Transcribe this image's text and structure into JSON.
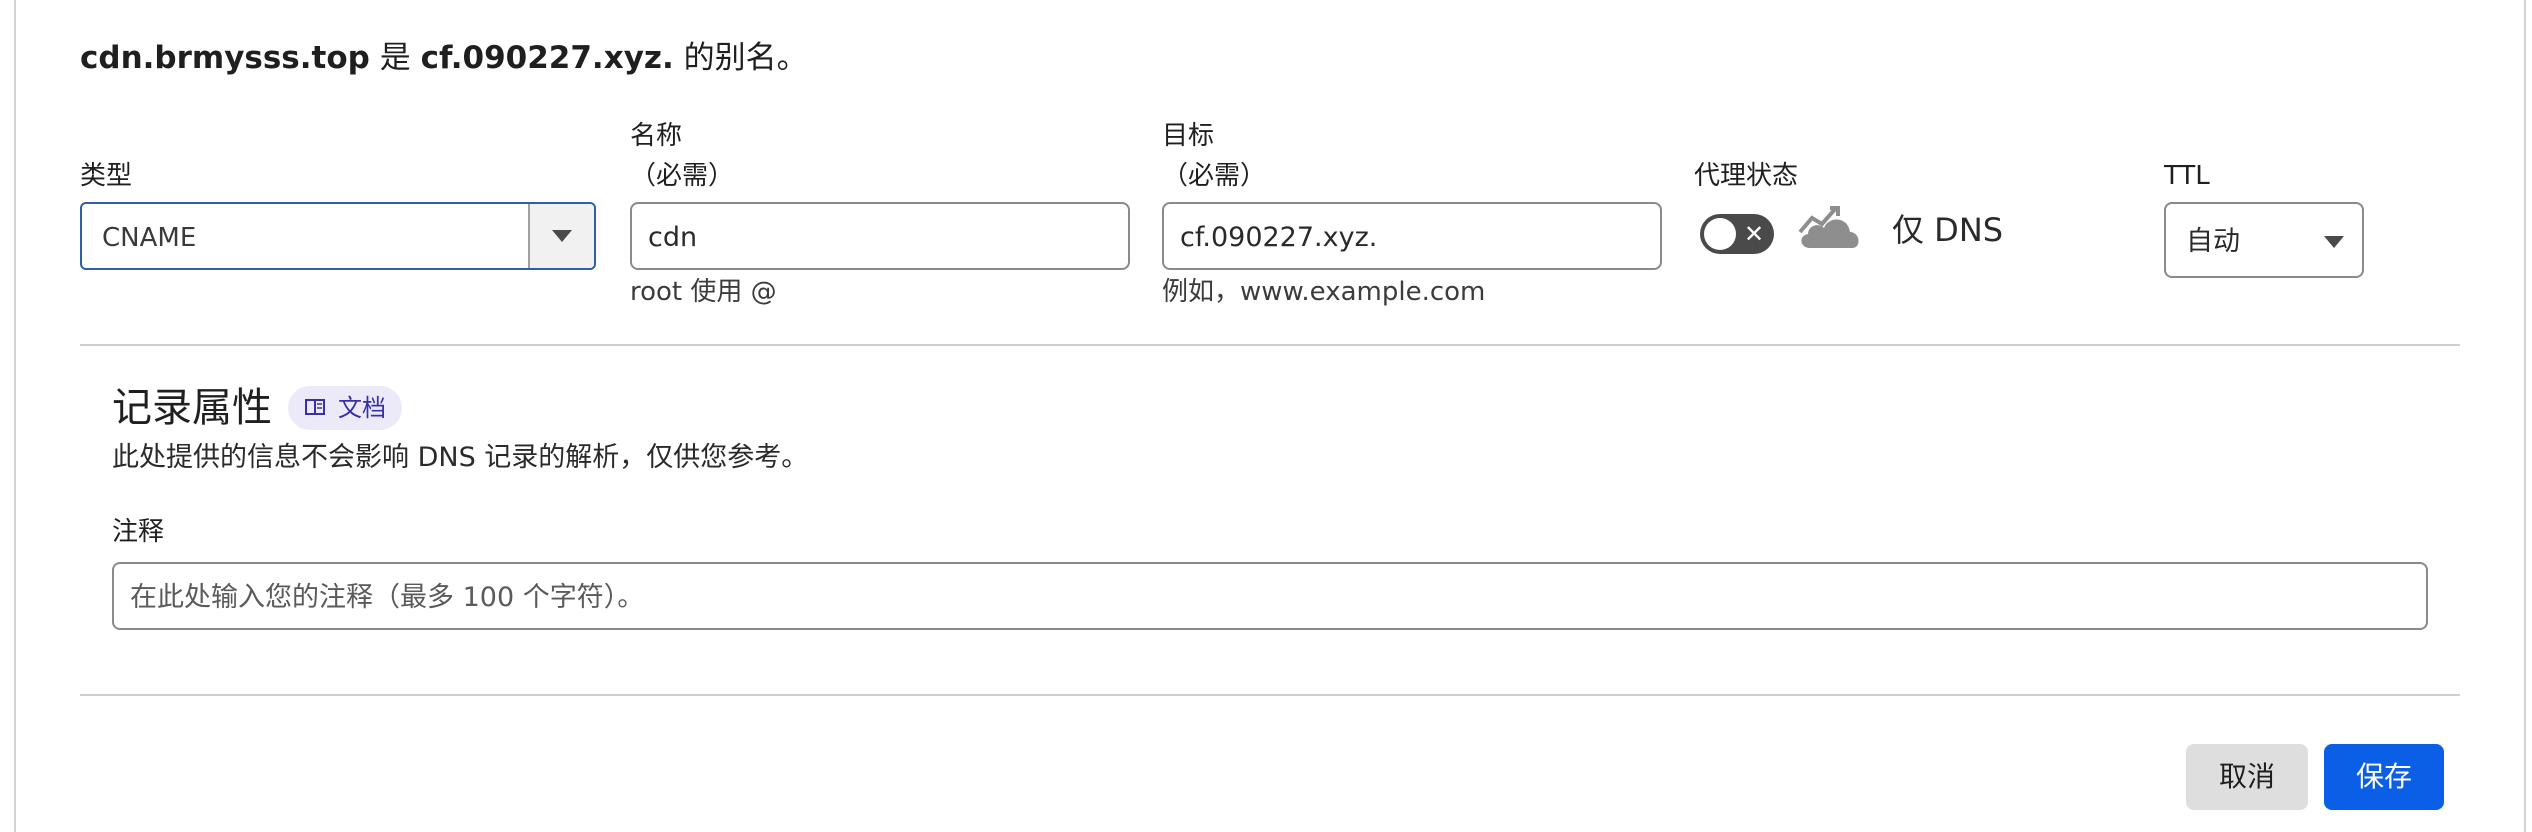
{
  "alias_note": {
    "host": "cdn.brmysss.top",
    "is_text": "是",
    "target": "cf.090227.xyz.",
    "suffix": "的别名。"
  },
  "fields": {
    "type": {
      "label": "类型",
      "value": "CNAME"
    },
    "name": {
      "label": "名称",
      "required": "（必需）",
      "value": "cdn",
      "hint": "root 使用 @"
    },
    "target": {
      "label": "目标",
      "required": "（必需）",
      "value": "cf.090227.xyz.",
      "hint": "例如，www.example.com"
    },
    "proxy": {
      "label": "代理状态",
      "state_text": "仅 DNS",
      "enabled": false,
      "toggle_icon": "x-icon",
      "cloud_icon": "cloud-icon"
    },
    "ttl": {
      "label": "TTL",
      "value": "自动"
    }
  },
  "record_attributes": {
    "title": "记录属性",
    "docs_label": "文档",
    "docs_icon": "book-icon",
    "description": "此处提供的信息不会影响 DNS 记录的解析，仅供您参考。",
    "comment": {
      "label": "注释",
      "placeholder": "在此处输入您的注释（最多 100 个字符）。"
    }
  },
  "actions": {
    "cancel_label": "取消",
    "save_label": "保存"
  },
  "colors": {
    "primary": "#0b5fe6",
    "focus_border": "#2f5fa6",
    "badge_bg": "#eceaf8",
    "badge_text": "#3a2fa8"
  }
}
